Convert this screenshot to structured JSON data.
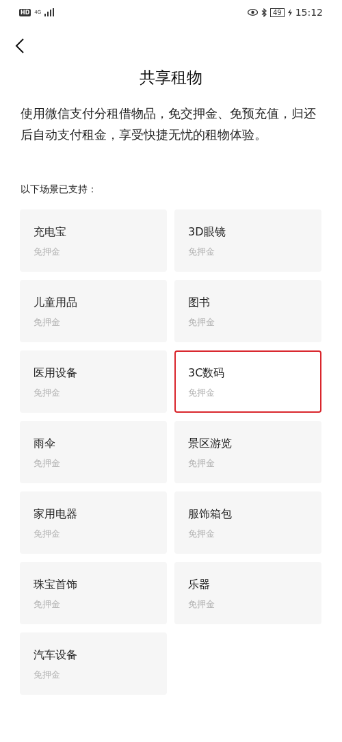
{
  "status_bar": {
    "hd": "HD",
    "network": "4G",
    "battery": "49",
    "time": "15:12"
  },
  "title": "共享租物",
  "description": "使用微信支付分租借物品，免交押金、免预充值，归还后自动支付租金，享受快捷无忧的租物体验。",
  "section_label": "以下场景已支持：",
  "scenes": [
    {
      "name": "充电宝",
      "note": "免押金",
      "highlighted": false
    },
    {
      "name": "3D眼镜",
      "note": "免押金",
      "highlighted": false
    },
    {
      "name": "儿童用品",
      "note": "免押金",
      "highlighted": false
    },
    {
      "name": "图书",
      "note": "免押金",
      "highlighted": false
    },
    {
      "name": "医用设备",
      "note": "免押金",
      "highlighted": false
    },
    {
      "name": "3C数码",
      "note": "免押金",
      "highlighted": true
    },
    {
      "name": "雨伞",
      "note": "免押金",
      "highlighted": false
    },
    {
      "name": "景区游览",
      "note": "免押金",
      "highlighted": false
    },
    {
      "name": "家用电器",
      "note": "免押金",
      "highlighted": false
    },
    {
      "name": "服饰箱包",
      "note": "免押金",
      "highlighted": false
    },
    {
      "name": "珠宝首饰",
      "note": "免押金",
      "highlighted": false
    },
    {
      "name": "乐器",
      "note": "免押金",
      "highlighted": false
    },
    {
      "name": "汽车设备",
      "note": "免押金",
      "highlighted": false
    }
  ]
}
